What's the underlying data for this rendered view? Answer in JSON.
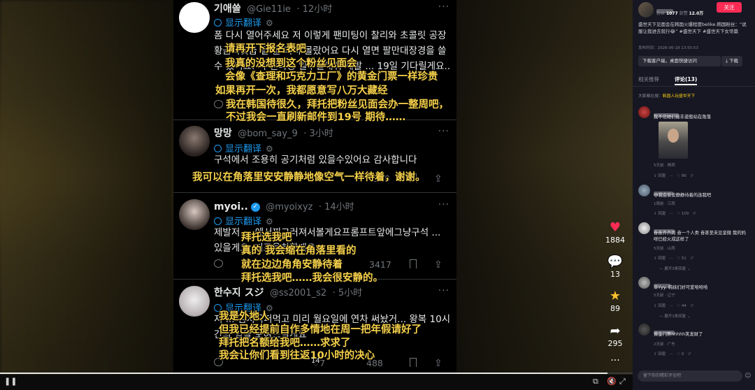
{
  "tweets": [
    {
      "name": "기애쓸",
      "handle": "@Gie11ie",
      "time": "· 12小时",
      "translate": "显示翻译",
      "body": "폼 다시 열어주세요 저 이렇게 팬미팅이 찰리와 초콜릿 공장 황금티켓급 될 줄 미처 몰랐어요 다시 열면 팔만대장경을 쓸 수 있어요. 저 팬미팅 일주일해줘 제발 ... 19일 기다릴게요..",
      "reply": "",
      "retweet": "",
      "like": "",
      "views": "5,627"
    },
    {
      "name": "망망",
      "handle": "@bom_say_9",
      "time": "· 3小时",
      "translate": "显示翻译",
      "body": "구석에서 조용히 공기처럼 있을수있어요 감사합니다",
      "reply": "",
      "retweet": "",
      "like": "",
      "views": "558"
    },
    {
      "name": "myoi..",
      "handle": "@myoixyz",
      "time": "· 14小时",
      "translate": "显示翻译",
      "body": "제발저 ... 에서찌그러져서볼게요프롬프트앞에그냥구석 ... 있을게요..저조용히할게요",
      "reply": "",
      "retweet": "",
      "like": "",
      "views": "3417"
    },
    {
      "name": "한수지 スジ",
      "handle": "@ss2001_s2",
      "time": "· 5小时",
      "translate": "显示翻译",
      "body": "저 ... 김치국퍼먹고 미리 월요일에 연차 써놨거... 왕복 10시간의 힘을 보여드릴게요",
      "reply": "",
      "retweet": "",
      "like": "7",
      "views": "488"
    }
  ],
  "subtitles": [
    "请再开下报名表吧",
    "我真的没想到这个粉丝见面会",
    "会像《查理和巧克力工厂》的黄金门票一样珍贵",
    "如果再开一次，我都愿意写八万大藏经",
    "我在韩国待很久，拜托把粉丝见面会办一整周吧，",
    "不过我会一直刷新邮件到19号 期待……",
    "我可以在角落里安安静静地像空气一样待着，谢谢。",
    "拜托选我吧",
    "真的 我会缩在角落里看的",
    "就在边边角角安静待着",
    "拜托选我吧……我会很安静的。",
    "我是外地人",
    "但我已经提前自作多情地在周一把年假请好了",
    "拜托把名额给我吧……求求了",
    "我会让你们看到往返10小时的决心"
  ],
  "rail": {
    "likes": "1884",
    "comments": "13",
    "favorites": "89",
    "shares": "295"
  },
  "player": {
    "page": "14"
  },
  "progress": {
    "value": 0.96
  },
  "sidebar": {
    "fans_label": "粉丝",
    "fans": "1077",
    "likes_label": "获赞",
    "likes": "12.0万",
    "follow": "关注",
    "desc": "盛世天下见面会在韩国火爆程度belike.韩国粉丝：“说服让我进去就行😂” #盛世天下 #盛世天下女帝篇",
    "published": "发布时间：2026-06-18 13:55:53",
    "download_client": "下载客户端，桌面快捷访问",
    "download": "⤓ 下载",
    "tab_related": "相关推荐",
    "tab_comments": "评论(13)",
    "search_hint_prefix": "大家都在搜：",
    "search_hint": "韩国人玩盛世天下",
    "comments": [
      {
        "text": "我不信她们能丰姿般站在角落",
        "meta": "5天前 · 陕西",
        "reply": "回复",
        "likes": "86"
      },
      {
        "text": "😅我会安安静静待着的连我吧",
        "meta": "1周前 · 江西",
        "reply": "回复",
        "likes": "109"
      },
      {
        "text": "奋奋齐齐跨 奋一个人类 奋甚至未见皇微 我的妈呀已经火成这样了",
        "meta": "5天前 · 山西",
        "reply": "回复",
        "likes": "51",
        "expand": "— 展开3条回复 ⌄"
      },
      {
        "text": "幸Yyy. 韩妹们好可爱哈哈哈",
        "meta": "5天前 · 辽宁",
        "reply": "回复",
        "likes": "44",
        "expand": "— 展开1条回复 ⌄"
      },
      {
        "text": "黄金门票hhhhh笑发财了",
        "meta": "2天前 · 广东",
        "reply": "回复",
        "likes": "0"
      }
    ],
    "input_placeholder": "留下你的精彩评论吧"
  }
}
